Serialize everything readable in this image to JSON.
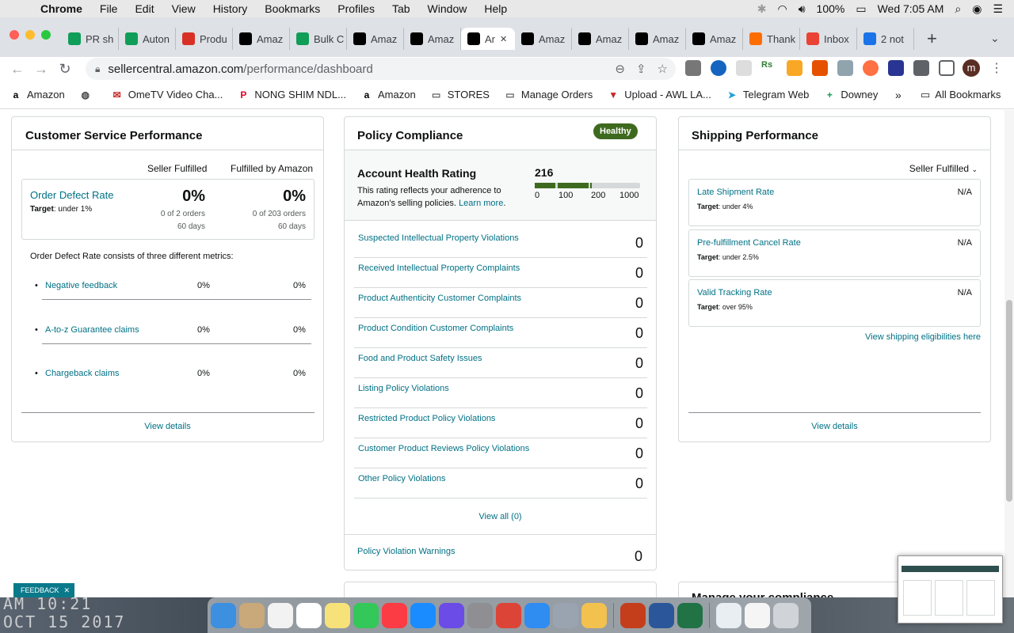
{
  "menubar": {
    "app_name": "Chrome",
    "items": [
      "File",
      "Edit",
      "View",
      "History",
      "Bookmarks",
      "Profiles",
      "Tab",
      "Window",
      "Help"
    ],
    "battery": "100%",
    "clock": "Wed 7:05 AM"
  },
  "tabs": [
    {
      "label": "PR sh",
      "icon": "sheets-icon",
      "color": "#0f9d58"
    },
    {
      "label": "Auton",
      "icon": "sheets-icon",
      "color": "#0f9d58"
    },
    {
      "label": "Produ",
      "icon": "pinwheel-icon",
      "color": "#d93025"
    },
    {
      "label": "Amaz",
      "icon": "amazon-icon",
      "color": "#000000"
    },
    {
      "label": "Bulk C",
      "icon": "sheets-icon",
      "color": "#0f9d58"
    },
    {
      "label": "Amaz",
      "icon": "amazon-icon",
      "color": "#000000"
    },
    {
      "label": "Amaz",
      "icon": "amazon-icon",
      "color": "#000000"
    },
    {
      "label": "Ar",
      "icon": "amazon-icon",
      "color": "#000000",
      "active": true
    },
    {
      "label": "Amaz",
      "icon": "amazon-icon",
      "color": "#000000"
    },
    {
      "label": "Amaz",
      "icon": "amazon-icon",
      "color": "#000000"
    },
    {
      "label": "Amaz",
      "icon": "amazon-icon",
      "color": "#000000"
    },
    {
      "label": "Amaz",
      "icon": "amazon-icon",
      "color": "#000000"
    },
    {
      "label": "Thank",
      "icon": "pencil-icon",
      "color": "#ff6d00"
    },
    {
      "label": "Inbox",
      "icon": "gmail-icon",
      "color": "#ea4335"
    },
    {
      "label": "2 not",
      "icon": "notification-icon",
      "color": "#1a73e8"
    }
  ],
  "address": {
    "host": "sellercentral.amazon.com",
    "path": "/performance/dashboard"
  },
  "bookmarks": [
    {
      "label": "Amazon",
      "icon": "amazon-icon"
    },
    {
      "label": "",
      "icon": "globe-icon"
    },
    {
      "label": "OmeTV Video Cha...",
      "icon": "gift-icon"
    },
    {
      "label": "NONG SHIM NDL...",
      "icon": "pinterest-icon"
    },
    {
      "label": "Amazon",
      "icon": "amazon-icon"
    },
    {
      "label": "STORES",
      "icon": "folder-icon"
    },
    {
      "label": "Manage Orders",
      "icon": "folder-icon"
    },
    {
      "label": "Upload - AWL LA...",
      "icon": "upload-icon"
    },
    {
      "label": "Telegram Web",
      "icon": "telegram-icon"
    },
    {
      "label": "Downey",
      "icon": "sheets-icon"
    }
  ],
  "bookmarks_more": "»",
  "all_bookmarks": "All Bookmarks",
  "customer_service": {
    "title": "Customer Service Performance",
    "col_seller": "Seller Fulfilled",
    "col_fba": "Fulfilled by Amazon",
    "odr": {
      "title": "Order Defect Rate",
      "target_label": "Target",
      "target": ": under 1%",
      "seller_value": "0%",
      "seller_orders": "0 of 2 orders",
      "seller_days": "60 days",
      "fba_value": "0%",
      "fba_orders": "0 of 203 orders",
      "fba_days": "60 days"
    },
    "consists": "Order Defect Rate consists of three different metrics:",
    "metrics": [
      {
        "name": "Negative feedback",
        "seller": "0%",
        "fba": "0%"
      },
      {
        "name": "A-to-z Guarantee claims",
        "seller": "0%",
        "fba": "0%"
      },
      {
        "name": "Chargeback claims",
        "seller": "0%",
        "fba": "0%"
      }
    ],
    "view_details": "View details"
  },
  "policy": {
    "title": "Policy Compliance",
    "status": "Healthy",
    "ahr_title": "Account Health Rating",
    "ahr_desc": "This rating reflects your adherence to Amazon's selling policies.",
    "learn_more": "Learn more",
    "ahr_end": ".",
    "score": "216",
    "score_value": 216,
    "ticks": [
      "0",
      "100",
      "200",
      "1000"
    ],
    "violations": [
      {
        "name": "Suspected Intellectual Property Violations",
        "count": "0"
      },
      {
        "name": "Received Intellectual Property Complaints",
        "count": "0"
      },
      {
        "name": "Product Authenticity Customer Complaints",
        "count": "0"
      },
      {
        "name": "Product Condition Customer Complaints",
        "count": "0"
      },
      {
        "name": "Food and Product Safety Issues",
        "count": "0"
      },
      {
        "name": "Listing Policy Violations",
        "count": "0"
      },
      {
        "name": "Restricted Product Policy Violations",
        "count": "0"
      },
      {
        "name": "Customer Product Reviews Policy Violations",
        "count": "0"
      },
      {
        "name": "Other Policy Violations",
        "count": "0"
      }
    ],
    "view_all": "View all (0)",
    "warnings_label": "Policy Violation Warnings",
    "warnings_count": "0"
  },
  "shipping": {
    "title": "Shipping Performance",
    "filter": "Seller Fulfilled",
    "metrics": [
      {
        "name": "Late Shipment Rate",
        "target_label": "Target",
        "target": ": under 4%",
        "value": "N/A"
      },
      {
        "name": "Pre-fulfillment Cancel Rate",
        "target_label": "Target",
        "target": ": under 2.5%",
        "value": "N/A"
      },
      {
        "name": "Valid Tracking Rate",
        "target_label": "Target",
        "target": ": over 95%",
        "value": "N/A"
      }
    ],
    "eligibilities": "View shipping eligibilities here",
    "view_details": "View details"
  },
  "manage_title": "Manage your compliance",
  "feedback": "FEEDBACK",
  "desktop_clock": "AM 10:21\nOCT 15 2017",
  "colors": {
    "link": "#007185",
    "healthy": "#3e6a1f",
    "feedback": "#0a7a8a"
  }
}
